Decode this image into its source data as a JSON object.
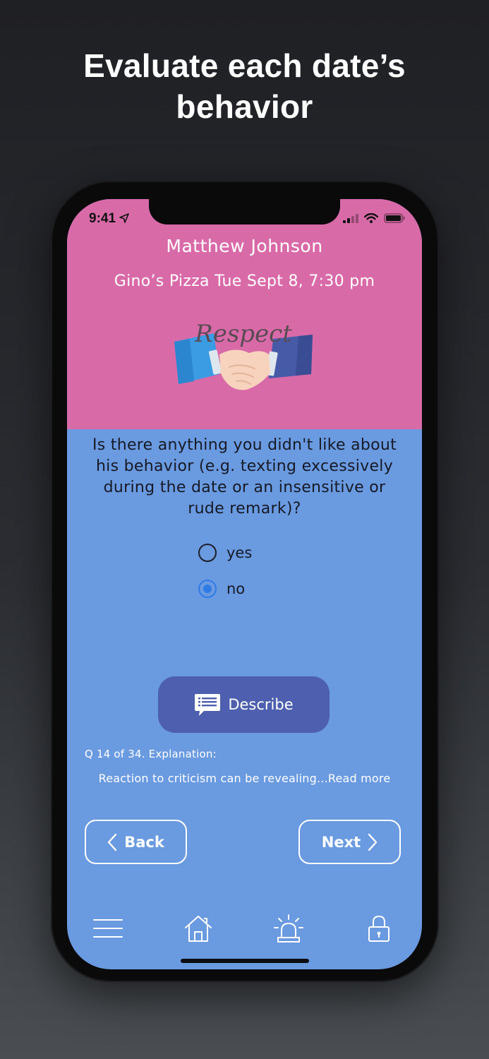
{
  "headline": {
    "line1": "Evaluate each date’s",
    "line2": "behavior"
  },
  "status_bar": {
    "time": "9:41"
  },
  "date_info": {
    "name": "Matthew Johnson",
    "venue": "Gino’s Pizza  Tue Sept 8, 7:30 pm",
    "topic_image_text": "Respect"
  },
  "question": {
    "text": "Is there anything you didn't like about his behavior (e.g. texting excessively during the date or an insensitive or rude remark)?",
    "options": [
      {
        "label": "yes",
        "selected": false
      },
      {
        "label": "no",
        "selected": true
      }
    ]
  },
  "describe_button": {
    "label": "Describe"
  },
  "explanation": {
    "counter": "Q 14 of 34. Explanation:",
    "text": "Reaction to criticism can be revealing...Read more"
  },
  "navigation": {
    "back_label": "Back",
    "next_label": "Next"
  },
  "tab_bar": {
    "icons": [
      "menu-icon",
      "home-icon",
      "alarm-icon",
      "lock-icon"
    ]
  },
  "colors": {
    "header_pink": "#d96aa8",
    "body_blue": "#6a9ae0",
    "button_indigo": "#4d5fae",
    "radio_selected": "#2f7be6"
  }
}
